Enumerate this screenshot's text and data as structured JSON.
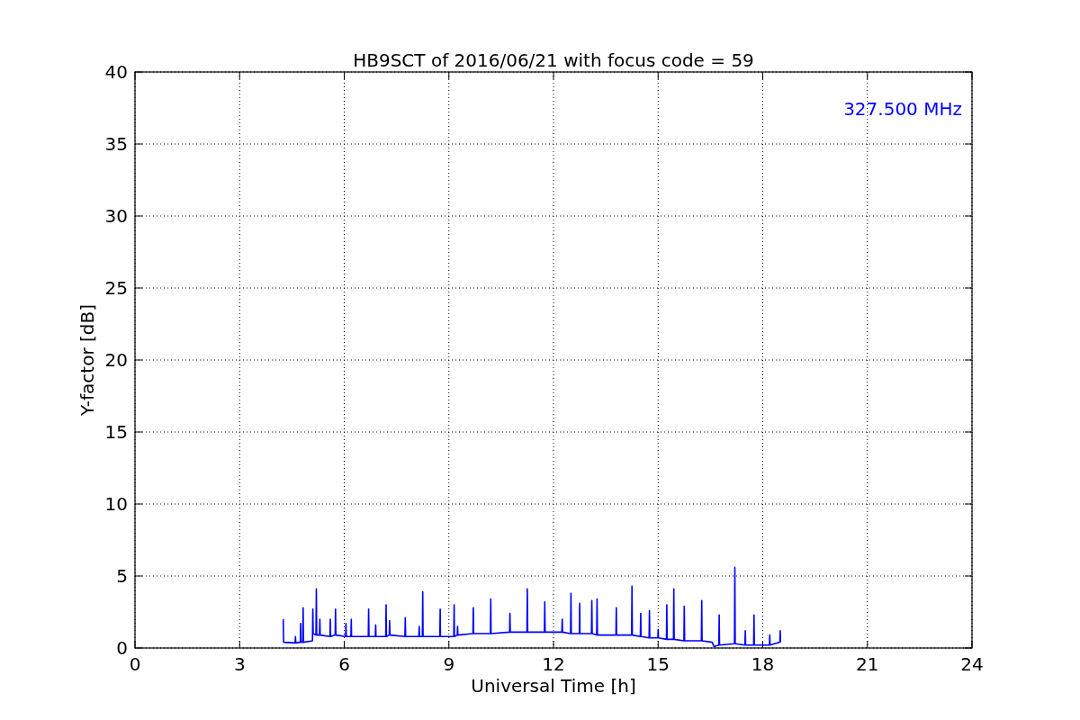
{
  "chart_data": {
    "type": "line",
    "title": "HB9SCT of 2016/06/21 with focus code = 59",
    "xlabel": "Universal Time [h]",
    "ylabel": "Y-factor [dB]",
    "xlim": [
      0,
      24
    ],
    "ylim": [
      0,
      40
    ],
    "grid": true,
    "xticks": [
      0,
      3,
      6,
      9,
      12,
      15,
      18,
      21,
      24
    ],
    "yticks": [
      0,
      5,
      10,
      15,
      20,
      25,
      30,
      35,
      40
    ],
    "x": [
      4.25,
      4.26,
      4.59,
      4.6,
      4.61,
      4.74,
      4.75,
      4.76,
      4.81,
      4.82,
      4.83,
      5.09,
      5.1,
      5.11,
      5.19,
      5.2,
      5.21,
      5.29,
      5.3,
      5.31,
      5.59,
      5.6,
      5.61,
      5.74,
      5.75,
      5.76,
      6.04,
      6.05,
      6.06,
      6.19,
      6.2,
      6.21,
      6.69,
      6.7,
      6.71,
      6.89,
      6.9,
      6.91,
      7.19,
      7.2,
      7.21,
      7.29,
      7.3,
      7.31,
      7.74,
      7.75,
      7.76,
      8.14,
      8.15,
      8.16,
      8.24,
      8.25,
      8.26,
      8.74,
      8.75,
      8.76,
      9.14,
      9.15,
      9.16,
      9.24,
      9.25,
      9.26,
      9.69,
      9.7,
      9.71,
      10.19,
      10.2,
      10.21,
      10.74,
      10.75,
      10.76,
      11.24,
      11.25,
      11.26,
      11.74,
      11.75,
      11.76,
      12.24,
      12.25,
      12.26,
      12.49,
      12.5,
      12.51,
      12.74,
      12.75,
      12.76,
      13.09,
      13.1,
      13.11,
      13.24,
      13.25,
      13.26,
      13.79,
      13.8,
      13.81,
      14.24,
      14.25,
      14.26,
      14.49,
      14.5,
      14.51,
      14.74,
      14.75,
      14.76,
      14.99,
      15.0,
      15.01,
      15.24,
      15.25,
      15.26,
      15.44,
      15.45,
      15.46,
      15.74,
      15.75,
      15.76,
      16.24,
      16.25,
      16.26,
      16.55,
      16.6,
      16.74,
      16.75,
      16.76,
      17.19,
      17.2,
      17.21,
      17.49,
      17.5,
      17.51,
      17.74,
      17.75,
      17.76,
      18.19,
      18.2,
      18.21,
      18.49,
      18.5,
      18.51
    ],
    "series": [
      {
        "name": "327.500 MHz",
        "color": "#0000ff",
        "values": [
          2.0,
          0.4,
          0.35,
          0.8,
          0.35,
          0.4,
          1.7,
          0.4,
          0.4,
          2.8,
          0.4,
          0.5,
          2.7,
          1.0,
          0.9,
          4.1,
          0.9,
          0.9,
          2.0,
          0.9,
          0.8,
          2.0,
          0.8,
          0.9,
          2.7,
          0.9,
          0.8,
          1.7,
          0.8,
          0.8,
          2.0,
          0.8,
          0.8,
          2.7,
          0.8,
          0.8,
          1.6,
          0.8,
          0.8,
          3.0,
          0.8,
          0.9,
          1.9,
          0.9,
          0.8,
          2.1,
          0.8,
          0.8,
          1.5,
          0.8,
          0.8,
          3.9,
          0.8,
          0.8,
          2.7,
          0.8,
          0.8,
          3.0,
          0.8,
          0.9,
          1.5,
          0.9,
          1.0,
          2.8,
          1.0,
          1.0,
          3.4,
          1.0,
          1.1,
          2.4,
          1.1,
          1.1,
          4.1,
          1.1,
          1.1,
          3.2,
          1.1,
          1.1,
          2.0,
          1.1,
          1.0,
          3.8,
          1.0,
          1.0,
          3.1,
          1.0,
          1.0,
          3.3,
          1.0,
          0.9,
          3.4,
          0.9,
          0.9,
          2.8,
          0.9,
          0.9,
          4.3,
          0.9,
          0.8,
          2.4,
          0.8,
          0.7,
          2.6,
          0.7,
          0.7,
          1.3,
          0.7,
          0.6,
          3.0,
          0.6,
          0.6,
          4.1,
          0.6,
          0.5,
          2.9,
          0.5,
          0.5,
          3.3,
          0.5,
          0.4,
          0.1,
          0.2,
          2.3,
          0.2,
          0.3,
          5.6,
          0.3,
          0.2,
          1.2,
          0.2,
          0.2,
          2.3,
          0.2,
          0.2,
          0.9,
          0.2,
          0.4,
          1.2,
          0.4
        ]
      }
    ]
  }
}
